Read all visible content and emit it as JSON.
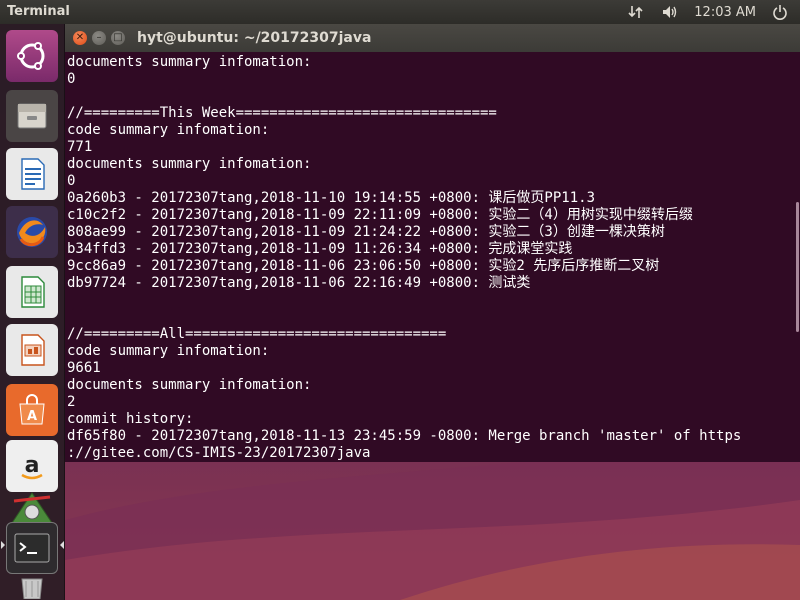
{
  "top_panel": {
    "app_title": "Terminal",
    "clock": "12:03 AM",
    "indicators": [
      "network-icon",
      "volume-icon",
      "power-icon"
    ]
  },
  "launcher": {
    "items": [
      {
        "name": "ubuntu-dash-icon"
      },
      {
        "name": "files-icon"
      },
      {
        "name": "libreoffice-writer-icon"
      },
      {
        "name": "firefox-icon"
      },
      {
        "name": "libreoffice-calc-icon"
      },
      {
        "name": "libreoffice-impress-icon"
      },
      {
        "name": "software-center-icon"
      },
      {
        "name": "amazon-icon"
      },
      {
        "name": "update-manager-icon"
      },
      {
        "name": "terminal-icon"
      },
      {
        "name": "trash-icon"
      }
    ]
  },
  "terminal": {
    "title": "hyt@ubuntu: ~/20172307java",
    "lines": [
      "documents summary infomation:",
      "0",
      "",
      "//=========This Week===============================",
      "code summary infomation:",
      "771",
      "documents summary infomation:",
      "0",
      "0a260b3 - 20172307tang,2018-11-10 19:14:55 +0800: 课后做页PP11.3",
      "c10c2f2 - 20172307tang,2018-11-09 22:11:09 +0800: 实验二（4）用树实现中缀转后缀",
      "808ae99 - 20172307tang,2018-11-09 21:24:22 +0800: 实验二（3）创建一棵决策树",
      "b34ffd3 - 20172307tang,2018-11-09 11:26:34 +0800: 完成课堂实践",
      "9cc86a9 - 20172307tang,2018-11-06 23:06:50 +0800: 实验2 先序后序推断二叉树",
      "db97724 - 20172307tang,2018-11-06 22:16:49 +0800: 测试类",
      "",
      "",
      "//=========All===============================",
      "code summary infomation:",
      "9661",
      "documents summary infomation:",
      "2",
      "commit history:",
      "df65f80 - 20172307tang,2018-11-13 23:45:59 -0800: Merge branch 'master' of https",
      "://gitee.com/CS-IMIS-23/20172307java"
    ]
  },
  "colors": {
    "terminal_bg": "#300a24",
    "terminal_fg": "#ffffff",
    "panel_bg": "#3c3b37",
    "close_button": "#df4a16"
  }
}
